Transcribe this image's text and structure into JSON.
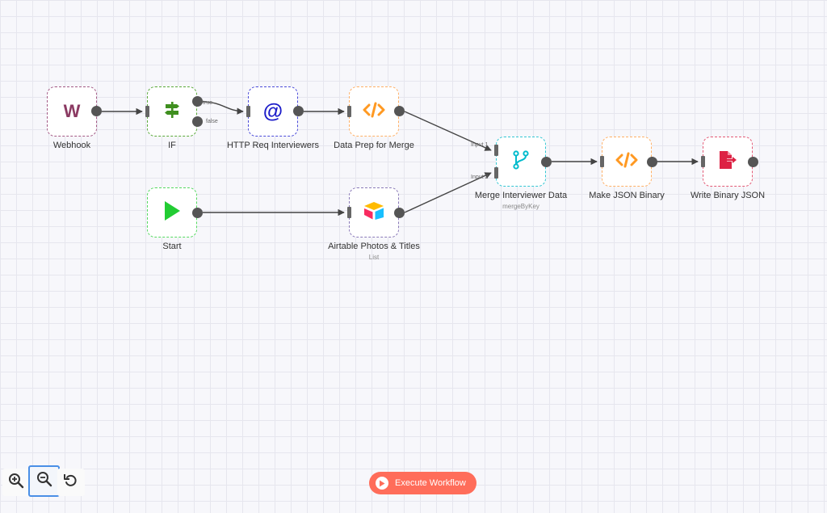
{
  "colors": {
    "webhook": "#8b3a62",
    "if": "#3f8f1f",
    "http": "#1c1cc9",
    "function": "#ff9922",
    "merge": "#00bbcc",
    "start": "#22cc33",
    "write": "#dd2244",
    "execute": "#ff6d5a"
  },
  "nodes": {
    "webhook": {
      "label": "Webhook",
      "icon_letter": "W",
      "icon": "webhook-icon"
    },
    "if": {
      "label": "IF",
      "icon": "signpost-icon",
      "out_true": "true",
      "out_false": "false"
    },
    "http": {
      "label": "HTTP Req Interviewers",
      "icon_glyph": "@",
      "icon": "at-sign-icon"
    },
    "data_prep": {
      "label": "Data Prep for Merge",
      "icon": "code-icon"
    },
    "merge": {
      "label": "Merge Interviewer Data",
      "sub": "mergeByKey",
      "icon": "branch-merge-icon",
      "input1": "Input 1",
      "input2": "Input 2"
    },
    "make_json": {
      "label": "Make JSON Binary",
      "icon": "code-icon"
    },
    "write_json": {
      "label": "Write Binary JSON",
      "icon": "file-export-icon"
    },
    "start": {
      "label": "Start",
      "icon": "play-icon"
    },
    "airtable": {
      "label": "Airtable Photos & Titles",
      "sub": "List",
      "icon": "airtable-icon"
    }
  },
  "toolbar": {
    "zoom_in": "zoom-in-icon",
    "zoom_out": "zoom-out-icon",
    "reset": "reset-zoom-icon"
  },
  "execute": {
    "label": "Execute Workflow"
  }
}
